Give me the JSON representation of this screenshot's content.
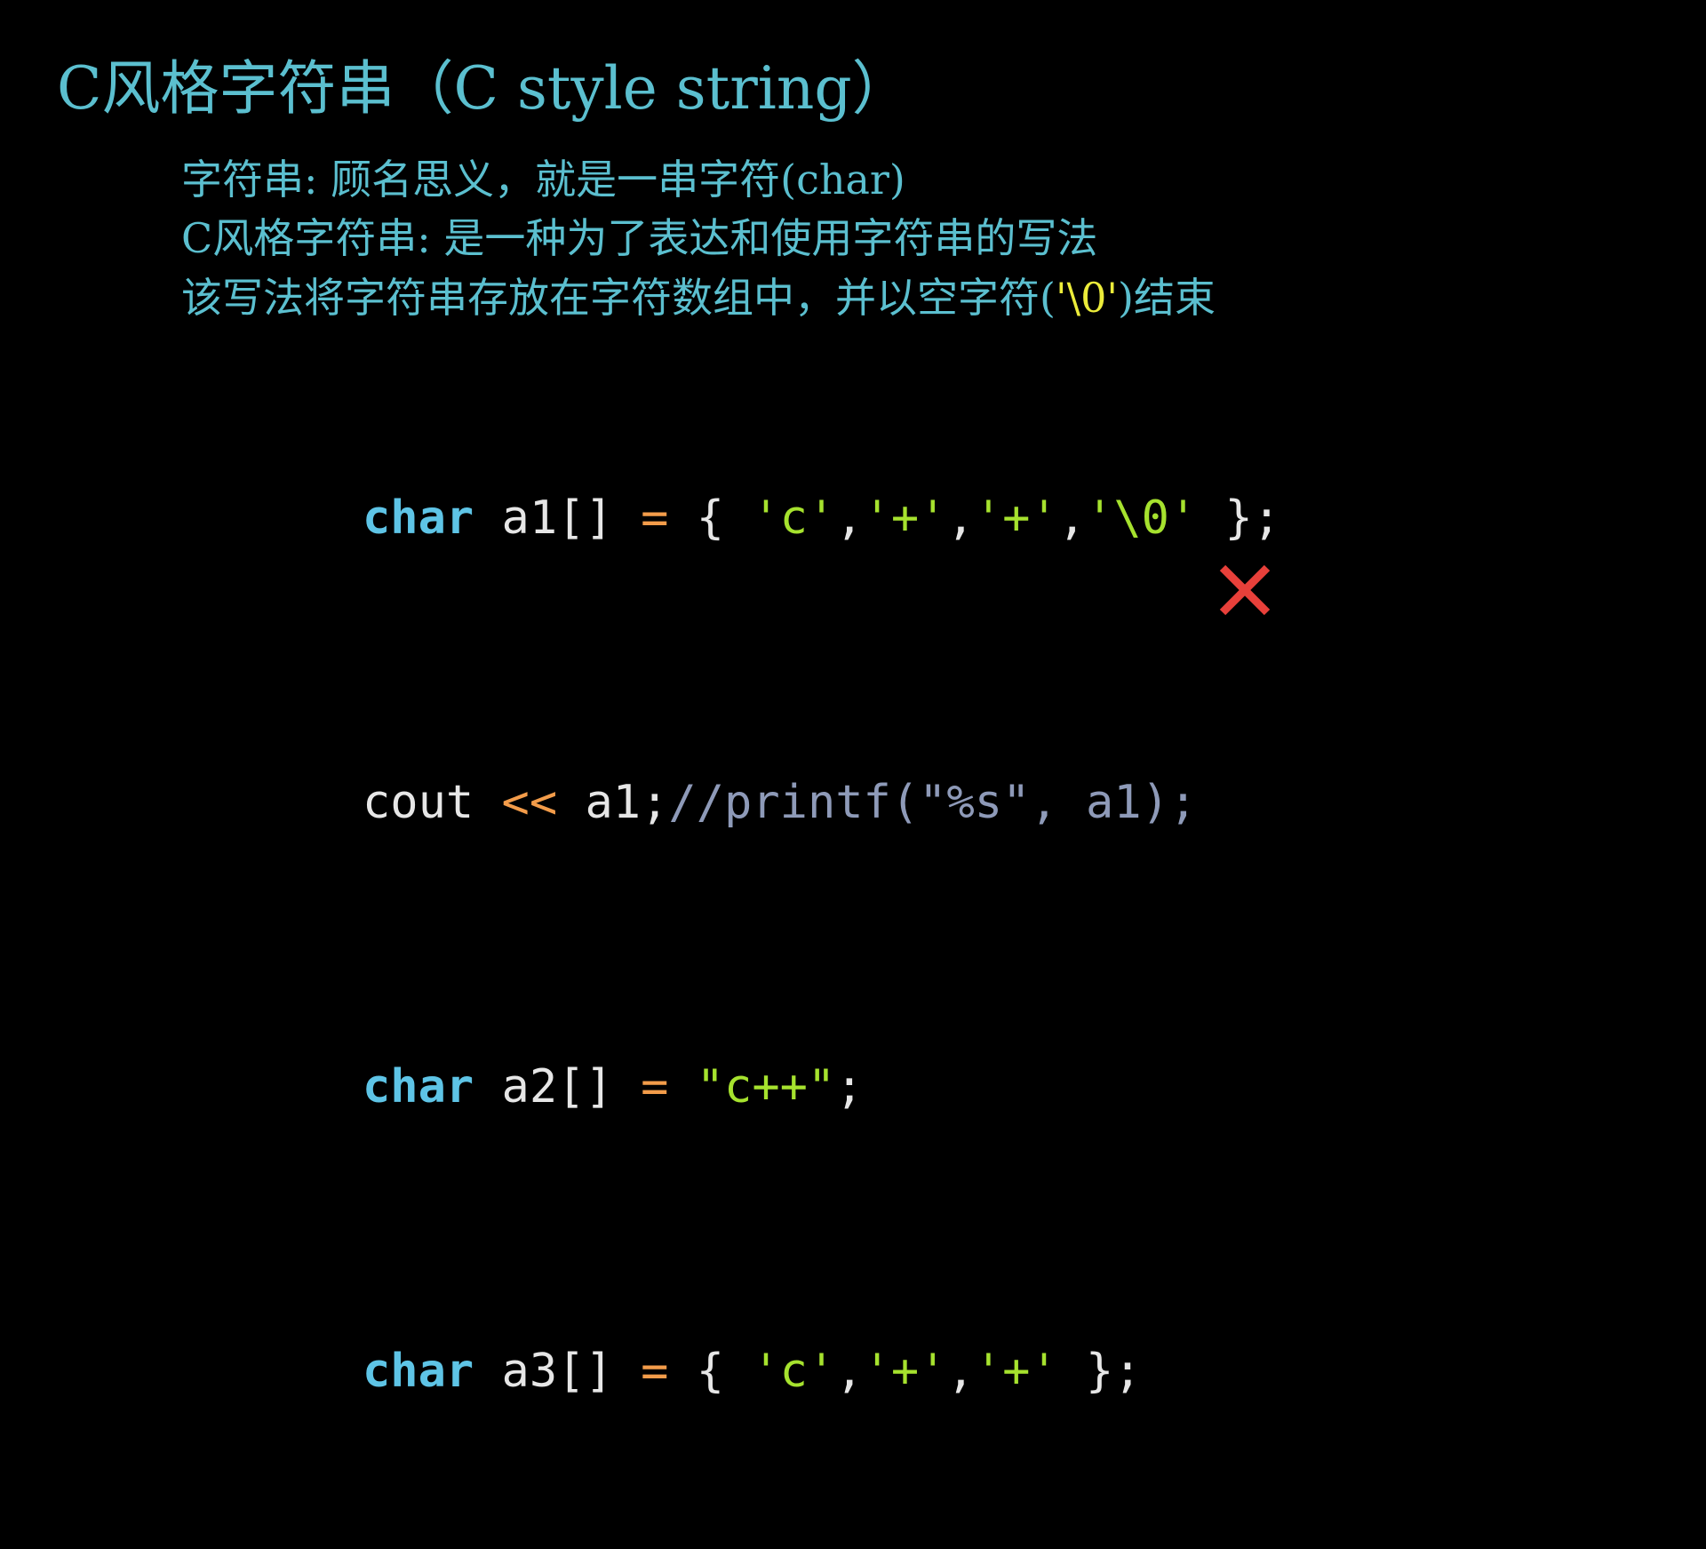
{
  "slide": {
    "title": "C风格字符串（C style string）",
    "lines": {
      "line1": "字符串: 顾名思义，就是一串字符(char)",
      "line2": "C风格字符串: 是一种为了表达和使用字符串的写法",
      "line3_before": "该写法将字符串存放在字符数组中，并以空字符(",
      "line3_highlight": "'\\0'",
      "line3_after": ")结束"
    },
    "code": {
      "line1": {
        "kw": "char",
        "name": " a1[] ",
        "op": "=",
        "open": " { ",
        "s1": "'c'",
        "c1": ",",
        "s2": "'+'",
        "c2": ",",
        "s3": "'+'",
        "c3": ",",
        "s4": "'\\0'",
        "close": " };"
      },
      "line2": {
        "name": "cout ",
        "op": "<<",
        "rest": " a1;",
        "comment": "//printf(\"%s\", a1);"
      },
      "line3": {
        "kw": "char",
        "name": " a2[] ",
        "op": "=",
        "sp": " ",
        "str": "\"c++\"",
        "end": ";"
      },
      "line4": {
        "kw": "char",
        "name": " a3[] ",
        "op": "=",
        "open": " { ",
        "s1": "'c'",
        "c1": ",",
        "s2": "'+'",
        "c2": ",",
        "s3": "'+'",
        "close": " };"
      }
    },
    "icons": {
      "wrong_mark": "cross-icon"
    },
    "colors": {
      "background": "#000000",
      "heading": "#5bbfcf",
      "highlight": "#ecec3a",
      "keyword": "#5ec4e6",
      "operator": "#f39c4a",
      "string": "#a6e22e",
      "comment": "#8e9ab8",
      "cross": "#e8403a"
    }
  }
}
